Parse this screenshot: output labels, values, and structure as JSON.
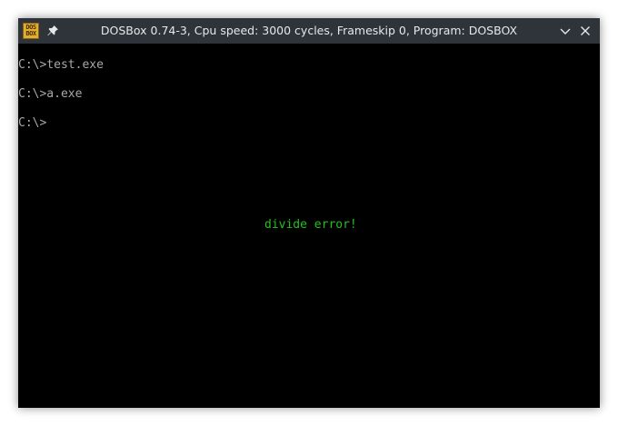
{
  "window": {
    "title": "DOSBox 0.74-3, Cpu speed: 3000 cycles, Frameskip 0, Program: DOSBOX",
    "app_icon_text_top": "DOS",
    "app_icon_text_bottom": "BOX",
    "icons": {
      "app": "dosbox-icon",
      "pin": "pin-icon",
      "minimize": "chevron-down-icon",
      "close": "close-icon"
    }
  },
  "console": {
    "lines": [
      "C:\\>test.exe",
      "C:\\>a.exe",
      "C:\\>"
    ],
    "error_message": "divide error!",
    "colors": {
      "background": "#000000",
      "text": "#a8a8a8",
      "error": "#22c020"
    }
  }
}
